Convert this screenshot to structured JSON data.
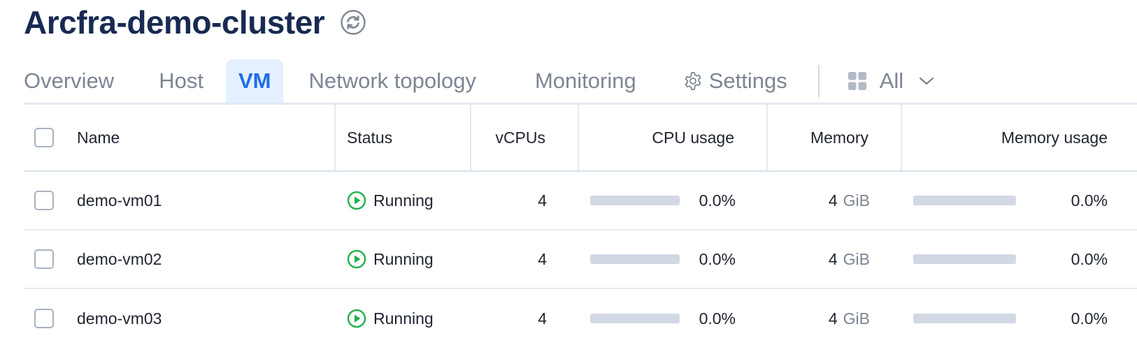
{
  "header": {
    "title": "Arcfra-demo-cluster",
    "refresh_icon": "refresh-icon"
  },
  "tabs": [
    {
      "label": "Overview",
      "active": false
    },
    {
      "label": "Host",
      "active": false
    },
    {
      "label": "VM",
      "active": true
    },
    {
      "label": "Network topology",
      "active": false
    },
    {
      "label": "Monitoring",
      "active": false
    },
    {
      "label": "Settings",
      "active": false,
      "icon": "gear-icon"
    }
  ],
  "view_filter": {
    "value": "All",
    "icon": "grid-icon"
  },
  "table": {
    "columns": {
      "name": "Name",
      "status": "Status",
      "vcpus": "vCPUs",
      "cpu_usage": "CPU usage",
      "memory": "Memory",
      "memory_usage": "Memory usage"
    },
    "rows": [
      {
        "name": "demo-vm01",
        "status": "Running",
        "vcpus": "4",
        "cpu_usage": "0.0%",
        "cpu_fraction": 0.0,
        "memory_value": "4",
        "memory_unit": "GiB",
        "memory_usage": "0.0%",
        "memory_fraction": 0.0
      },
      {
        "name": "demo-vm02",
        "status": "Running",
        "vcpus": "4",
        "cpu_usage": "0.0%",
        "cpu_fraction": 0.0,
        "memory_value": "4",
        "memory_unit": "GiB",
        "memory_usage": "0.0%",
        "memory_fraction": 0.0
      },
      {
        "name": "demo-vm03",
        "status": "Running",
        "vcpus": "4",
        "cpu_usage": "0.0%",
        "cpu_fraction": 0.0,
        "memory_value": "4",
        "memory_unit": "GiB",
        "memory_usage": "0.0%",
        "memory_fraction": 0.0
      }
    ]
  },
  "colors": {
    "title": "#182a52",
    "active_tab": "#1f6ee8",
    "active_tab_bg": "#e4efff",
    "running_status": "#22b14c",
    "usage_track": "#d3d8e5"
  }
}
